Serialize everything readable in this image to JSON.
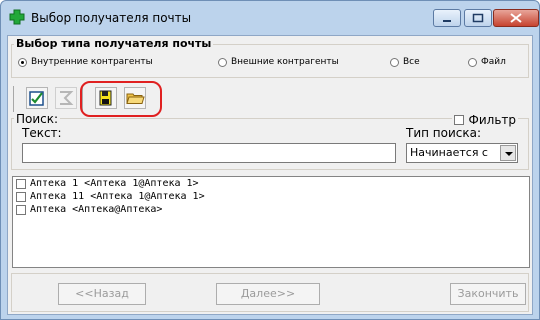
{
  "window": {
    "title": "Выбор получателя почты",
    "icon": "green-cross-icon",
    "controls": [
      "minimize-icon",
      "maximize-icon",
      "close-icon"
    ]
  },
  "recipient_type": {
    "title": "Выбор типа получателя почты",
    "options": [
      {
        "label": "Внутренние контрагенты",
        "checked": true
      },
      {
        "label": "Внешние контрагенты",
        "checked": false
      },
      {
        "label": "Все",
        "checked": false
      },
      {
        "label": "Файл",
        "checked": false
      }
    ]
  },
  "toolbar": {
    "buttons": [
      "check-all-icon",
      "clear-selection-icon",
      "save-icon",
      "open-folder-icon"
    ],
    "highlight_color": "#e02020"
  },
  "search": {
    "title": "Поиск:",
    "filter_label": "Фильтр",
    "text_label": "Текст:",
    "text_value": "",
    "type_label": "Тип поиска:",
    "type_value": "Начинается с"
  },
  "recipients": [
    {
      "name": "Аптека 1 <Аптека 1@Аптека 1>",
      "checked": false
    },
    {
      "name": "Аптека 11 <Аптека 1@Аптека 1>",
      "checked": false
    },
    {
      "name": "Аптека <Аптека@Аптека>",
      "checked": false
    }
  ],
  "footer": {
    "back": "<<Назад",
    "next": "Далее>>",
    "finish": "Закончить"
  }
}
